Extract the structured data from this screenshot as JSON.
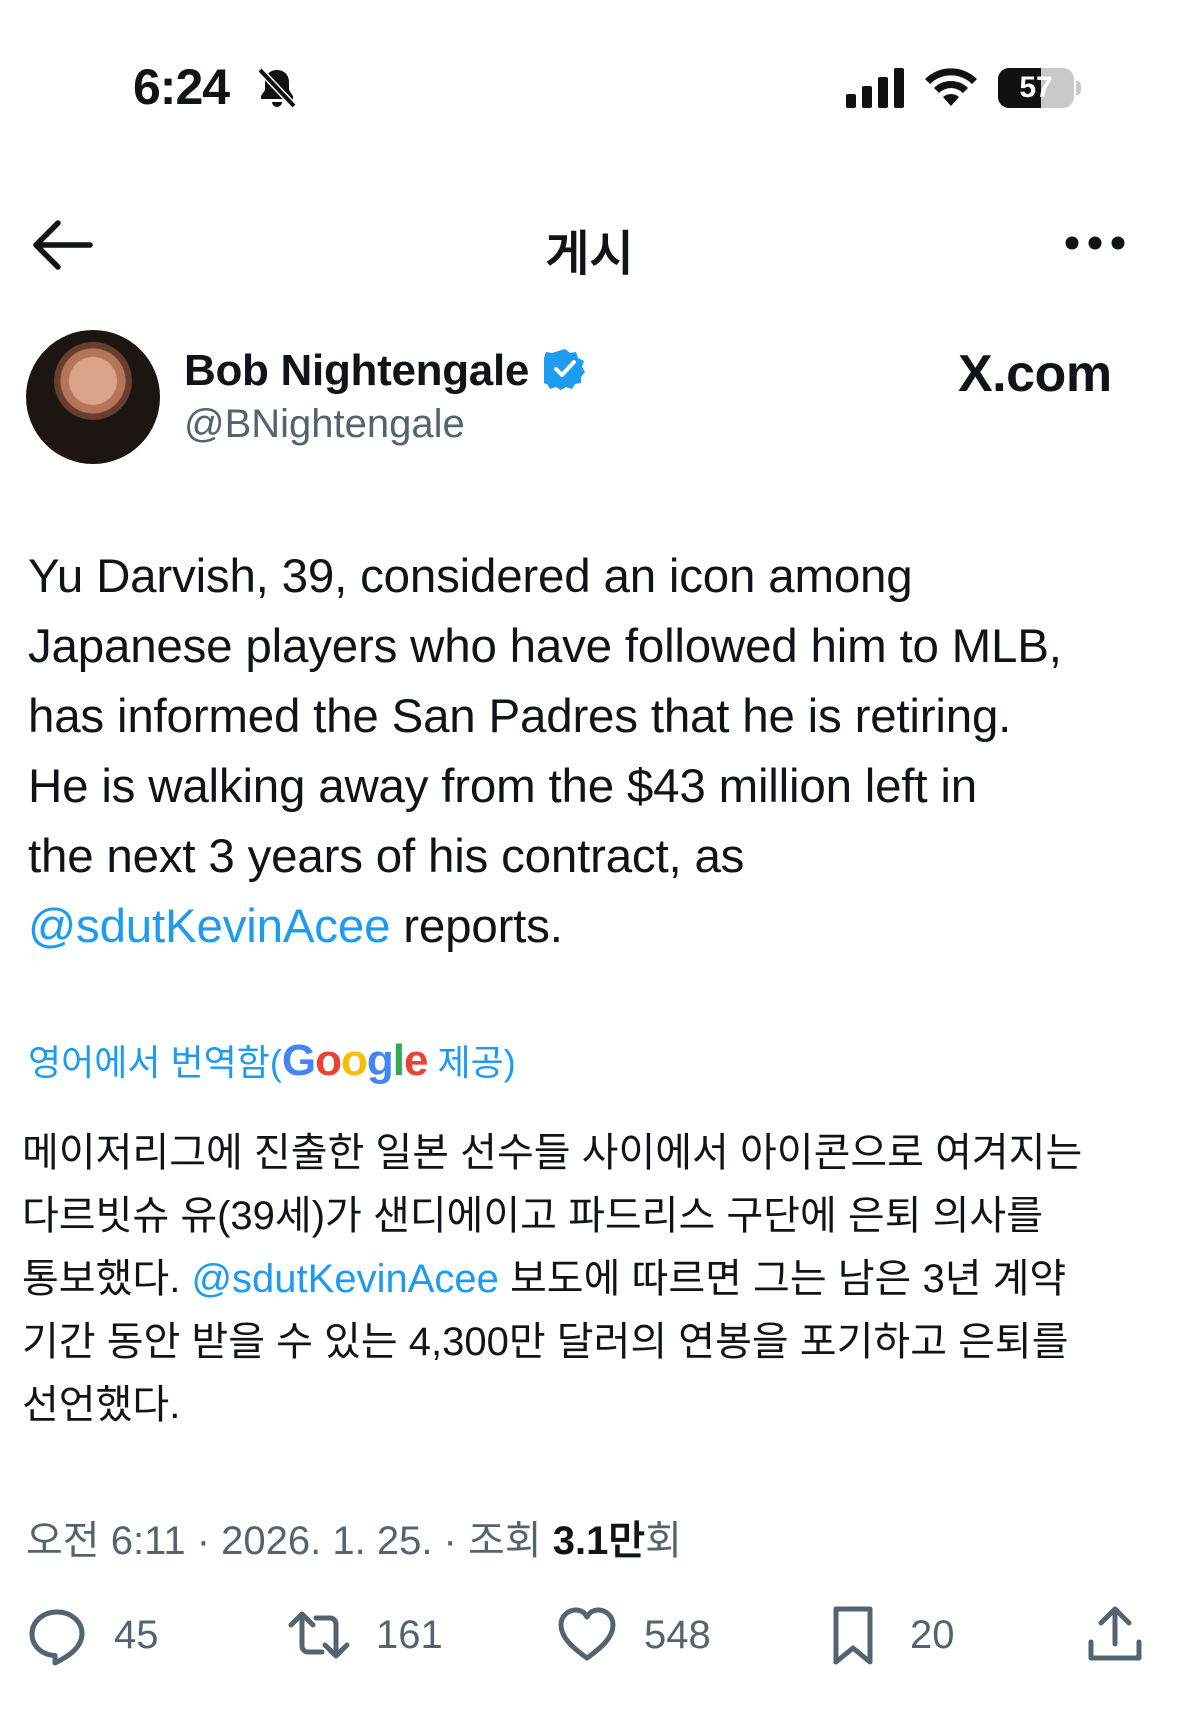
{
  "status_bar": {
    "time": "6:24",
    "battery": "57",
    "battery_level_percent": 57
  },
  "header": {
    "title": "게시"
  },
  "author": {
    "name": "Bob Nightengale",
    "handle": "@BNightengale",
    "source": "X.com"
  },
  "tweet": {
    "lines": [
      "Yu Darvish, 39, considered an icon among",
      "Japanese players who have followed him to MLB,",
      "has informed the San Padres that he is retiring.",
      "He is walking away from the $43 million left in",
      "the next 3 years of his contract, as"
    ],
    "mention": "@sdutKevinAcee",
    "last_suffix": " reports."
  },
  "translation": {
    "label_prefix": "영어에서 번역함(",
    "google_letters": [
      "G",
      "o",
      "o",
      "g",
      "l",
      "e"
    ],
    "google_colors": [
      "#4285F4",
      "#EA4335",
      "#FBBC05",
      "#4285F4",
      "#34A853",
      "#EA4335"
    ],
    "label_suffix": " 제공)",
    "lines": [
      "메이저리그에 진출한 일본 선수들 사이에서 아이콘으로 여겨지는",
      "다르빗슈 유(39세)가 샌디에이고 파드리스 구단에 은퇴 의사를"
    ],
    "line3_prefix": "통보했다. ",
    "line3_mention": "@sdutKevinAcee",
    "line3_suffix": " 보도에 따르면 그는 남은 3년 계약",
    "lines_after": [
      "기간 동안 받을 수 있는 4,300만 달러의 연봉을 포기하고 은퇴를",
      "선언했다."
    ]
  },
  "meta": {
    "time_date": "오전 6:11 · 2026. 1. 25. · 조회 ",
    "views": "3.1만",
    "views_suffix": "회"
  },
  "actions": {
    "replies": "45",
    "reposts": "161",
    "likes": "548",
    "bookmarks": "20"
  },
  "colors": {
    "accent": "#1d9bf0",
    "text": "#0f1419",
    "secondary": "#536471"
  }
}
